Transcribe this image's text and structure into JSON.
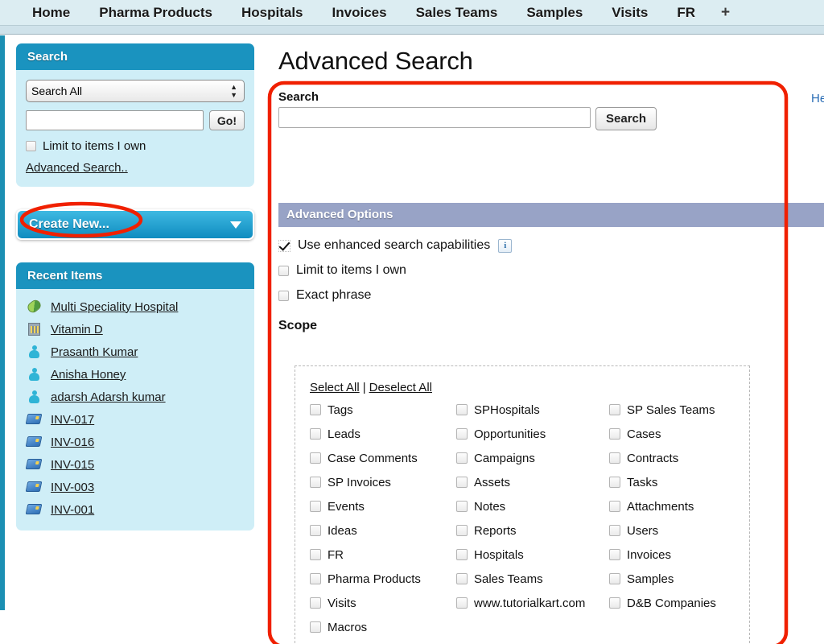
{
  "topnav": {
    "tabs": [
      {
        "label": "Home"
      },
      {
        "label": "Pharma Products"
      },
      {
        "label": "Hospitals"
      },
      {
        "label": "Invoices"
      },
      {
        "label": "Sales Teams"
      },
      {
        "label": "Samples"
      },
      {
        "label": "Visits"
      },
      {
        "label": "FR"
      },
      {
        "label": "+"
      }
    ]
  },
  "sidebar": {
    "search_panel": {
      "title": "Search",
      "scope_selected": "Search All",
      "scope_options": [
        "Search All"
      ],
      "query_value": "",
      "query_placeholder": "",
      "go_label": "Go!",
      "limit_label": "Limit to items I own",
      "limit_checked": false,
      "advanced_link": "Advanced Search.."
    },
    "create_new": {
      "label": "Create New...",
      "icon": "chevron-down-icon"
    },
    "recent_items": {
      "title": "Recent Items",
      "items": [
        {
          "label": "Multi Speciality Hospital",
          "icon": "pill-icon"
        },
        {
          "label": "Vitamin D",
          "icon": "building-icon"
        },
        {
          "label": "Prasanth Kumar",
          "icon": "person-icon"
        },
        {
          "label": "Anisha Honey",
          "icon": "person-icon"
        },
        {
          "label": "adarsh Adarsh kumar",
          "icon": "person-icon"
        },
        {
          "label": "INV-017",
          "icon": "card-icon"
        },
        {
          "label": "INV-016",
          "icon": "card-icon"
        },
        {
          "label": "INV-015",
          "icon": "card-icon"
        },
        {
          "label": "INV-003",
          "icon": "card-icon"
        },
        {
          "label": "INV-001",
          "icon": "card-icon"
        }
      ]
    }
  },
  "main": {
    "page_title": "Advanced Search",
    "search_label": "Search",
    "search_value": "",
    "search_placeholder": "",
    "search_button": "Search",
    "advanced_options_title": "Advanced Options",
    "options": [
      {
        "label": "Use enhanced search capabilities",
        "checked": true,
        "info": "i"
      },
      {
        "label": "Limit to items I own",
        "checked": false
      },
      {
        "label": "Exact phrase",
        "checked": false
      }
    ],
    "scope_heading": "Scope",
    "select_all": "Select All",
    "deselect_all": "Deselect All",
    "separator": "|",
    "scope_items": [
      {
        "label": "Tags",
        "checked": false
      },
      {
        "label": "SPHospitals",
        "checked": false
      },
      {
        "label": "SP Sales Teams",
        "checked": false
      },
      {
        "label": "Leads",
        "checked": false
      },
      {
        "label": "Opportunities",
        "checked": false
      },
      {
        "label": "Cases",
        "checked": false
      },
      {
        "label": "Case Comments",
        "checked": false
      },
      {
        "label": "Campaigns",
        "checked": false
      },
      {
        "label": "Contracts",
        "checked": false
      },
      {
        "label": "SP Invoices",
        "checked": false
      },
      {
        "label": "Assets",
        "checked": false
      },
      {
        "label": "Tasks",
        "checked": false
      },
      {
        "label": "Events",
        "checked": false
      },
      {
        "label": "Notes",
        "checked": false
      },
      {
        "label": "Attachments",
        "checked": false
      },
      {
        "label": "Ideas",
        "checked": false
      },
      {
        "label": "Reports",
        "checked": false
      },
      {
        "label": "Users",
        "checked": false
      },
      {
        "label": "FR",
        "checked": false
      },
      {
        "label": "Hospitals",
        "checked": false
      },
      {
        "label": "Invoices",
        "checked": false
      },
      {
        "label": "Pharma Products",
        "checked": false
      },
      {
        "label": "Sales Teams",
        "checked": false
      },
      {
        "label": "Samples",
        "checked": false
      },
      {
        "label": "Visits",
        "checked": false
      },
      {
        "label": "www.tutorialkart.com",
        "checked": false
      },
      {
        "label": "D&B Companies",
        "checked": false
      },
      {
        "label": "Macros",
        "checked": false
      }
    ]
  },
  "help_link": "He",
  "colors": {
    "nav_bg": "#dcedf2",
    "panel_header": "#1a93bf",
    "panel_body": "#cfeef7",
    "advanced_options_bar": "#98a3c6",
    "annotation_red": "#f02000",
    "link_blue": "#2a6db5",
    "left_rail": "#1b8fb3"
  }
}
